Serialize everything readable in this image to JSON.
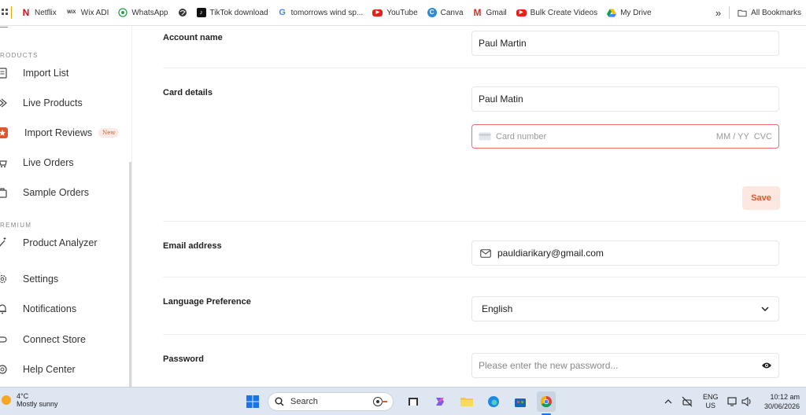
{
  "bookmarks": [
    {
      "label": "Netflix",
      "icon": "netflix-icon"
    },
    {
      "label": "Wix ADI",
      "icon": "wix-icon"
    },
    {
      "label": "WhatsApp",
      "icon": "whatsapp-icon"
    },
    {
      "label": "",
      "icon": "globe-icon"
    },
    {
      "label": "TikTok download",
      "icon": "tiktok-icon"
    },
    {
      "label": "tomorrows wind sp...",
      "icon": "google-icon"
    },
    {
      "label": "YouTube",
      "icon": "youtube-icon"
    },
    {
      "label": "Canva",
      "icon": "canva-icon"
    },
    {
      "label": "Gmail",
      "icon": "gmail-icon"
    },
    {
      "label": "Bulk Create Videos",
      "icon": "youtube-icon"
    },
    {
      "label": "My Drive",
      "icon": "drive-icon"
    }
  ],
  "bookmarks_more": "»",
  "all_bookmarks": "All Bookmarks",
  "sidebar": {
    "section_products": "RODUCTS",
    "section_premium": "REMIUM",
    "items": [
      {
        "label": "Import List",
        "icon": "list-icon"
      },
      {
        "label": "Live Products",
        "icon": "tag-icon"
      },
      {
        "label": "Import Reviews",
        "icon": "star-icon",
        "badge": "New"
      },
      {
        "label": "Live Orders",
        "icon": "cart-icon"
      },
      {
        "label": "Sample Orders",
        "icon": "bag-icon"
      },
      {
        "label": "Product Analyzer",
        "icon": "wand-icon"
      },
      {
        "label": "Settings",
        "icon": "gear-icon"
      },
      {
        "label": "Notifications",
        "icon": "bell-icon"
      },
      {
        "label": "Connect Store",
        "icon": "link-icon"
      },
      {
        "label": "Help Center",
        "icon": "help-icon"
      }
    ]
  },
  "form": {
    "account_name_label": "Account name",
    "account_name_value": "Paul Martin",
    "card_details_label": "Card details",
    "card_holder_value": "Paul Matin",
    "card_number_placeholder": "Card number",
    "card_expiry_cvc": "MM / YY  CVC",
    "save_label": "Save",
    "email_label": "Email address",
    "email_value": "pauldiarikary@gmail.com",
    "language_label": "Language Preference",
    "language_value": "English",
    "password_label": "Password",
    "password_placeholder": "Please enter the new password..."
  },
  "colors": {
    "accent": "#e4552b",
    "card_border": "#e8706a",
    "save_bg": "#fde8e1"
  },
  "taskbar": {
    "weather_temp": "4°C",
    "weather_desc": "Mostly sunny",
    "search_label": "Search",
    "lang_top": "ENG",
    "lang_bottom": "US",
    "time": "10:12 am",
    "date": "30/06/2026"
  }
}
